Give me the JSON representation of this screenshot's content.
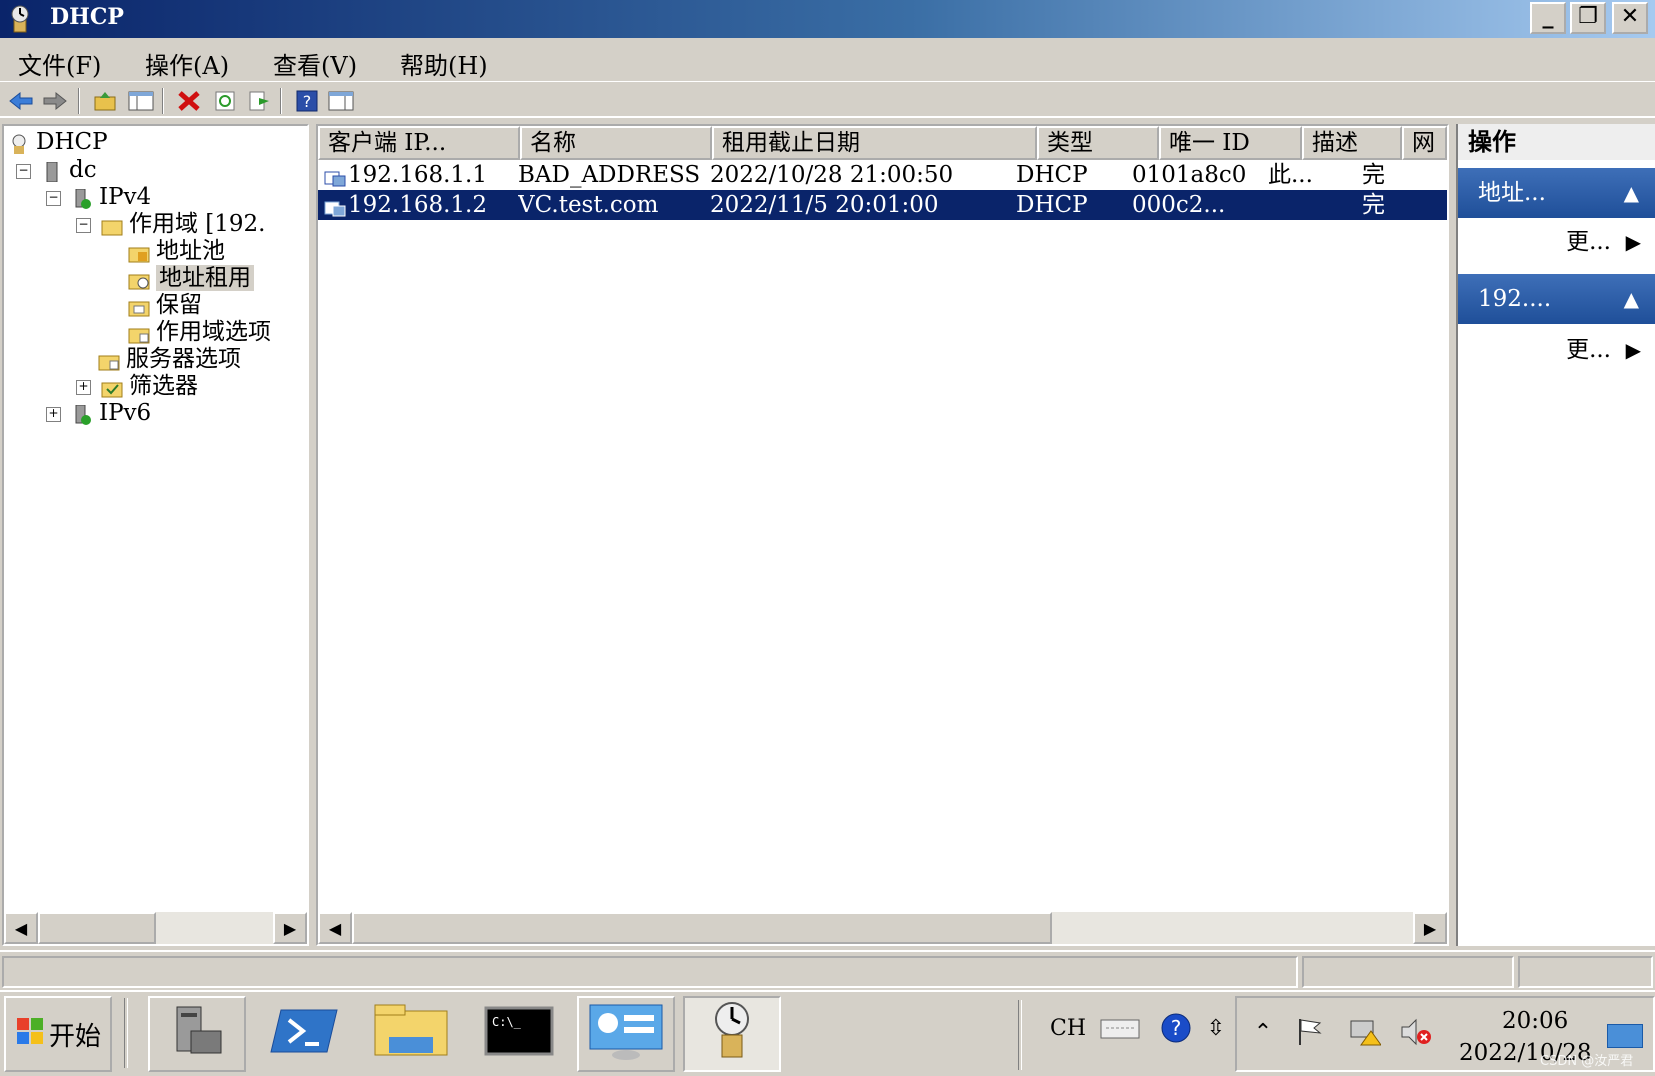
{
  "window": {
    "title": "DHCP"
  },
  "menu": {
    "file": "文件(F)",
    "action": "操作(A)",
    "view": "查看(V)",
    "help": "帮助(H)"
  },
  "tree": {
    "root": "DHCP",
    "server": "dc",
    "ipv4": "IPv4",
    "scope": "作用域 [192.",
    "address_pool": "地址池",
    "address_leases": "地址租用",
    "reservations": "保留",
    "scope_options": "作用域选项",
    "server_options": "服务器选项",
    "filters": "筛选器",
    "ipv6": "IPv6"
  },
  "list": {
    "columns": [
      "客户端 IP...",
      "名称",
      "租用截止日期",
      "类型",
      "唯一 ID",
      "描述",
      "网"
    ],
    "rows": [
      [
        "192.168.1.1",
        "BAD_ADDRESS",
        "2022/10/28 21:00:50",
        "DHCP",
        "0101a8c0",
        "此...",
        "完"
      ],
      [
        "192.168.1.2",
        "VC.test.com",
        "2022/11/5 20:01:00",
        "DHCP",
        "000c2...",
        "",
        "完"
      ]
    ]
  },
  "actions": {
    "title": "操作",
    "section1": "地址...",
    "more1": "更...",
    "section2": "192....",
    "more2": "更..."
  },
  "taskbar": {
    "start": "开始",
    "lang": "CH",
    "time": "20:06",
    "date": "2022/10/28"
  },
  "watermark": "CSDN @汝严君",
  "colors": {
    "titlebar": "#0a246a",
    "selection": "#0a246a",
    "action_section": "#2a5aa8"
  }
}
